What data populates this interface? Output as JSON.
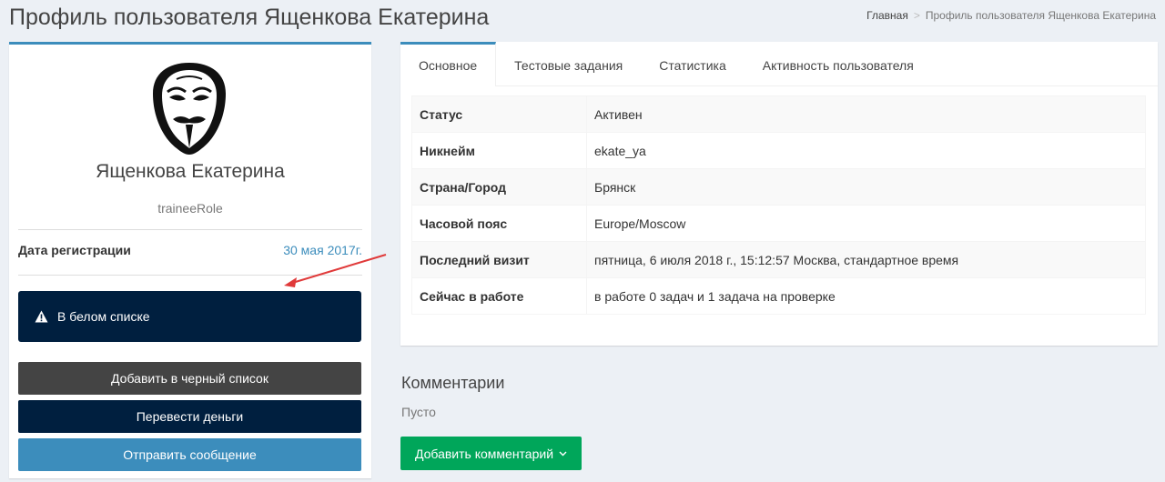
{
  "header": {
    "title": "Профиль пользователя Ященкова Екатерина",
    "breadcrumb": {
      "home": "Главная",
      "current": "Профиль пользователя Ященкова Екатерина"
    }
  },
  "profile": {
    "name": "Ященкова Екатерина",
    "role": "traineeRole",
    "reg_label": "Дата регистрации",
    "reg_value": "30 мая 2017г.",
    "whitelist_label": "В белом списке",
    "buttons": {
      "blacklist": "Добавить в черный список",
      "transfer": "Перевести деньги",
      "message": "Отправить сообщение"
    }
  },
  "tabs": [
    {
      "label": "Основное"
    },
    {
      "label": "Тестовые задания"
    },
    {
      "label": "Статистика"
    },
    {
      "label": "Активность пользователя"
    }
  ],
  "info_rows": [
    {
      "key": "Статус",
      "value": "Активен"
    },
    {
      "key": "Никнейм",
      "value": "ekate_ya"
    },
    {
      "key": "Страна/Город",
      "value": "Брянск"
    },
    {
      "key": "Часовой пояс",
      "value": "Europe/Moscow"
    },
    {
      "key": "Последний визит",
      "value": "пятница, 6 июля 2018 г., 15:12:57 Москва, стандартное время"
    },
    {
      "key": "Сейчас в работе",
      "value": "в работе 0 задач и 1 задача на проверке"
    }
  ],
  "comments": {
    "title": "Комментарии",
    "empty": "Пусто",
    "add_button": "Добавить комментарий"
  },
  "icons": {
    "avatar": "guy-fawkes-mask-avatar",
    "whitelist": "warning-icon",
    "add_comment": "chevron-down-icon",
    "annotation": "red-arrow-icon"
  },
  "colors": {
    "primary": "#3c8dbc",
    "navy": "#001f3f",
    "dark": "#444444",
    "success": "#00a65a",
    "annotation": "#e03a3a"
  }
}
